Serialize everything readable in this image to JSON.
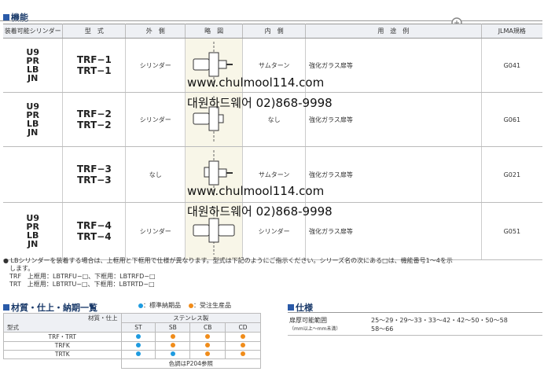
{
  "section1": {
    "title": "機能"
  },
  "colors": {
    "blue": "#1e9be0",
    "orange": "#f08c1a",
    "accent": "#2a5aa8"
  },
  "headers": [
    "装着可能シリンダー",
    "型　式",
    "外　側",
    "略　図",
    "内　側",
    "用　途　例",
    "JLMA規格"
  ],
  "rows": [
    {
      "series": [
        "U9",
        "PR",
        "LB",
        "JN"
      ],
      "models": [
        "TRF−1",
        "TRT−1"
      ],
      "outside": "シリンダー",
      "inside": "サムターン",
      "usage": "強化ガラス扉等",
      "jlma": "G041"
    },
    {
      "series": [
        "U9",
        "PR",
        "LB",
        "JN"
      ],
      "models": [
        "TRF−2",
        "TRT−2"
      ],
      "outside": "シリンダー",
      "inside": "なし",
      "usage": "強化ガラス扉等",
      "jlma": "G061"
    },
    {
      "series": [],
      "models": [
        "TRF−3",
        "TRT−3"
      ],
      "outside": "なし",
      "inside": "サムターン",
      "usage": "強化ガラス扉等",
      "jlma": "G021"
    },
    {
      "series": [
        "U9",
        "PR",
        "LB",
        "JN"
      ],
      "models": [
        "TRF−4",
        "TRT−4"
      ],
      "outside": "シリンダー",
      "inside": "シリンダー",
      "usage": "強化ガラス扉等",
      "jlma": "G051"
    }
  ],
  "watermark": {
    "url": "www.chulmool114.com",
    "company": "대원하드웨어 02)868-9998"
  },
  "notes": {
    "line1": "● LBシリンダーを装着する場合は、上框用と下框用で仕様が異なります。型式は下記のようにご指示ください。シリーズ名の次にある□は、機能番号1〜4を示",
    "line2": "　します。",
    "line3": "　TRF　上框用：LBTRFU−□、下框用：LBTRFD−□",
    "line4": "　TRT　上框用：LBTRTU−□、下框用：LBTRTD−□"
  },
  "section2": {
    "title": "材質・仕上・納期一覧",
    "legend_std": "：標準納期品",
    "legend_order": "：受注生産品"
  },
  "material": {
    "header_top": "材質・仕上",
    "header_model": "型式",
    "material_name": "ステンレス製",
    "finishes": [
      "ST",
      "SB",
      "CB",
      "CD"
    ],
    "rows": [
      {
        "model": "TRF・TRT",
        "dots": [
          "blue",
          "orange",
          "orange",
          "orange"
        ]
      },
      {
        "model": "TRFK",
        "dots": [
          "blue",
          "orange",
          "orange",
          "orange"
        ]
      },
      {
        "model": "TRTK",
        "dots": [
          "blue",
          "blue",
          "orange",
          "orange"
        ]
      }
    ],
    "footer": "色調はP204参照"
  },
  "section3": {
    "title": "仕様"
  },
  "spec": {
    "label": "扉厚可能範囲",
    "sublabel": "（mm以上〜mm未満）",
    "value1": "25〜29・29〜33・33〜42・42〜50・50〜58",
    "value2": "58〜66"
  }
}
